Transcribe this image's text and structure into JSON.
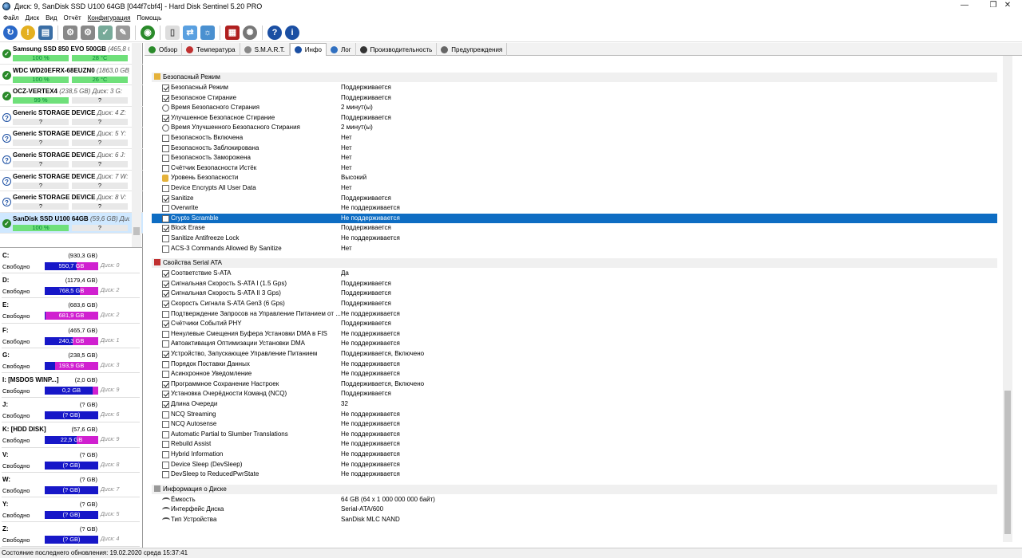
{
  "window": {
    "title": "Диск: 9, SanDisk SSD U100 64GB [044f7cbf4]  -  Hard Disk Sentinel 5.20 PRO"
  },
  "menu": [
    "Файл",
    "Диск",
    "Вид",
    "Отчёт",
    "Конфигурация",
    "Помощь"
  ],
  "disks": [
    {
      "name": "Samsung SSD 850 EVO 500GB",
      "info": "(465,8 GB)",
      "health": "100 %",
      "temp": "28 °C",
      "status": "ok"
    },
    {
      "name": "WDC WD20EFRX-68EUZN0",
      "info": "(1863,0 GB) Д",
      "health": "100 %",
      "temp": "26 °C",
      "status": "ok"
    },
    {
      "name": "OCZ-VERTEX4",
      "info": "(238,5 GB) Диск: 3  G:",
      "health": "99 %",
      "temp": "?",
      "status": "ok"
    },
    {
      "name": "Generic STORAGE DEVICE",
      "info": "Диск: 4  Z:",
      "health": "?",
      "temp": "?",
      "status": "q"
    },
    {
      "name": "Generic STORAGE DEVICE",
      "info": "Диск: 5  Y:",
      "health": "?",
      "temp": "?",
      "status": "q"
    },
    {
      "name": "Generic STORAGE DEVICE",
      "info": "Диск: 6  J:",
      "health": "?",
      "temp": "?",
      "status": "q"
    },
    {
      "name": "Generic STORAGE DEVICE",
      "info": "Диск: 7  W:",
      "health": "?",
      "temp": "?",
      "status": "q"
    },
    {
      "name": "Generic STORAGE DEVICE",
      "info": "Диск: 8  V:",
      "health": "?",
      "temp": "?",
      "status": "q"
    },
    {
      "name": "SanDisk SSD U100 64GB",
      "info": "(59,6 GB) Диск:",
      "health": "100 %",
      "temp": "?",
      "status": "ok"
    }
  ],
  "volumes": [
    {
      "letter": "C:",
      "size": "(930,3 GB)",
      "free_label": "Свободно",
      "free": "550,7 GB",
      "used_frac": 0.41,
      "disk": "Диск: 0"
    },
    {
      "letter": "D:",
      "size": "(1179,4 GB)",
      "free_label": "Свободно",
      "free": "768,5 GB",
      "used_frac": 0.35,
      "disk": "Диск: 2"
    },
    {
      "letter": "E:",
      "size": "(683,6 GB)",
      "free_label": "Свободно",
      "free": "681,9 GB",
      "used_frac": 0.99,
      "disk": "Диск: 2"
    },
    {
      "letter": "F:",
      "size": "(465,7 GB)",
      "free_label": "Свободно",
      "free": "240,3 GB",
      "used_frac": 0.48,
      "disk": "Диск: 1"
    },
    {
      "letter": "G:",
      "size": "(238,5 GB)",
      "free_label": "Свободно",
      "free": "193,9 GB",
      "used_frac": 0.81,
      "disk": "Диск: 3"
    },
    {
      "letter": "I: [MSDOS WINP...]",
      "size": "(2,0 GB)",
      "free_label": "Свободно",
      "free": "0,2 GB",
      "used_frac": 0.1,
      "disk": "Диск: 9"
    },
    {
      "letter": "J:",
      "size": "(? GB)",
      "free_label": "Свободно",
      "free": "(? GB)",
      "used_frac": 0,
      "disk": "Диск: 6"
    },
    {
      "letter": "K: [HDD DISK]",
      "size": "(57,6 GB)",
      "free_label": "Свободно",
      "free": "22,5 GB",
      "used_frac": 0.4,
      "disk": "Диск: 9"
    },
    {
      "letter": "V:",
      "size": "(? GB)",
      "free_label": "Свободно",
      "free": "(? GB)",
      "used_frac": 0,
      "disk": "Диск: 8"
    },
    {
      "letter": "W:",
      "size": "(? GB)",
      "free_label": "Свободно",
      "free": "(? GB)",
      "used_frac": 0,
      "disk": "Диск: 7"
    },
    {
      "letter": "Y:",
      "size": "(? GB)",
      "free_label": "Свободно",
      "free": "(? GB)",
      "used_frac": 0,
      "disk": "Диск: 5"
    },
    {
      "letter": "Z:",
      "size": "(? GB)",
      "free_label": "Свободно",
      "free": "(? GB)",
      "used_frac": 0,
      "disk": "Диск: 4"
    }
  ],
  "tabs": [
    {
      "label": "Обзор",
      "color": "#2a8a2a"
    },
    {
      "label": "Температура",
      "color": "#c03030"
    },
    {
      "label": "S.M.A.R.T.",
      "color": "#888888"
    },
    {
      "label": "Инфо",
      "color": "#1b4fa3",
      "active": true
    },
    {
      "label": "Лог",
      "color": "#3070c0"
    },
    {
      "label": "Производительность",
      "color": "#333333"
    },
    {
      "label": "Предупреждения",
      "color": "#666666"
    }
  ],
  "sections": [
    {
      "title": "Безопасный Режим",
      "icon": "lock-icon",
      "rows": [
        {
          "label": "Безопасный Режим",
          "value": "Поддерживается",
          "icon": "checked"
        },
        {
          "label": "Безопасное Стирание",
          "value": "Поддерживается",
          "icon": "checked"
        },
        {
          "label": "Время Безопасного Стирания",
          "value": "2 минут(ы)",
          "icon": "clock"
        },
        {
          "label": "Улучшенное Безопасное Стирание",
          "value": "Поддерживается",
          "icon": "checked"
        },
        {
          "label": "Время Улучшенного Безопасного Стирания",
          "value": "2 минут(ы)",
          "icon": "clock"
        },
        {
          "label": "Безопасность Включена",
          "value": "Нет",
          "icon": "unchecked"
        },
        {
          "label": "Безопасность Заблокирована",
          "value": "Нет",
          "icon": "unchecked"
        },
        {
          "label": "Безопасность Заморожена",
          "value": "Нет",
          "icon": "unchecked"
        },
        {
          "label": "Счётчик Безопасности Истёк",
          "value": "Нет",
          "icon": "unchecked"
        },
        {
          "label": "Уровень Безопасности",
          "value": "Высокий",
          "icon": "lock"
        },
        {
          "label": "Device Encrypts All User Data",
          "value": "Нет",
          "icon": "unchecked"
        },
        {
          "label": "Sanitize",
          "value": "Поддерживается",
          "icon": "checked"
        },
        {
          "label": "Overwrite",
          "value": "Не поддерживается",
          "icon": "unchecked"
        },
        {
          "label": "Crypto Scramble",
          "value": "Не поддерживается",
          "icon": "unchecked",
          "selected": true
        },
        {
          "label": "Block Erase",
          "value": "Поддерживается",
          "icon": "checked"
        },
        {
          "label": "Sanitize Antifreeze Lock",
          "value": "Не поддерживается",
          "icon": "unchecked"
        },
        {
          "label": "ACS-3 Commands Allowed By Sanitize",
          "value": "Нет",
          "icon": "unchecked"
        }
      ]
    },
    {
      "title": "Свойства Serial ATA",
      "icon": "sata-icon",
      "rows": [
        {
          "label": "Соответствие S-ATA",
          "value": "Да",
          "icon": "checked"
        },
        {
          "label": "Сигнальная Скорость S-ATA I (1.5 Gps)",
          "value": "Поддерживается",
          "icon": "checked"
        },
        {
          "label": "Сигнальная Скорость S-ATA II 3 Gps)",
          "value": "Поддерживается",
          "icon": "checked"
        },
        {
          "label": "Скорость Сигнала S-ATA Gen3 (6 Gps)",
          "value": "Поддерживается",
          "icon": "checked"
        },
        {
          "label": "Подтверждение Запросов на Управление Питанием от ...",
          "value": "Не поддерживается",
          "icon": "unchecked"
        },
        {
          "label": "Счётчики Событий PHY",
          "value": "Поддерживается",
          "icon": "checked"
        },
        {
          "label": "Ненулевые Смещения Буфера Установки DMA в FIS",
          "value": "Не поддерживается",
          "icon": "unchecked"
        },
        {
          "label": "Автоактивация Оптимизации Установки DMA",
          "value": "Не поддерживается",
          "icon": "unchecked"
        },
        {
          "label": "Устройство, Запускающее Управление Питанием",
          "value": "Поддерживается, Включено",
          "icon": "checked"
        },
        {
          "label": "Порядок Поставки Данных",
          "value": "Не поддерживается",
          "icon": "unchecked"
        },
        {
          "label": "Асинхронное Уведомление",
          "value": "Не поддерживается",
          "icon": "unchecked"
        },
        {
          "label": "Программное Сохранение Настроек",
          "value": "Поддерживается, Включено",
          "icon": "checked"
        },
        {
          "label": "Установка Очерёдности Команд (NCQ)",
          "value": "Поддерживается",
          "icon": "checked"
        },
        {
          "label": "Длина Очереди",
          "value": "32",
          "icon": "checked"
        },
        {
          "label": "NCQ Streaming",
          "value": "Не поддерживается",
          "icon": "unchecked"
        },
        {
          "label": "NCQ Autosense",
          "value": "Не поддерживается",
          "icon": "unchecked"
        },
        {
          "label": "Automatic Partial to Slumber Translations",
          "value": "Не поддерживается",
          "icon": "unchecked"
        },
        {
          "label": "Rebuild Assist",
          "value": "Не поддерживается",
          "icon": "unchecked"
        },
        {
          "label": "Hybrid Information",
          "value": "Не поддерживается",
          "icon": "unchecked"
        },
        {
          "label": "Device Sleep (DevSleep)",
          "value": "Не поддерживается",
          "icon": "unchecked"
        },
        {
          "label": "DevSleep to ReducedPwrState",
          "value": "Не поддерживается",
          "icon": "unchecked"
        }
      ]
    },
    {
      "title": "Информация о Диске",
      "icon": "drive-icon",
      "rows": [
        {
          "label": "Ёмкость",
          "value": "64 GB (64 x 1 000 000 000 байт)",
          "icon": "info"
        },
        {
          "label": "Интерфейс Диска",
          "value": "Serial-ATA/600",
          "icon": "info"
        },
        {
          "label": "Тип Устройства",
          "value": "SanDisk MLC NAND",
          "icon": "info"
        }
      ]
    }
  ],
  "status_bar": {
    "text": "Состояние последнего обновления: 19.02.2020 среда 15:37:41"
  }
}
